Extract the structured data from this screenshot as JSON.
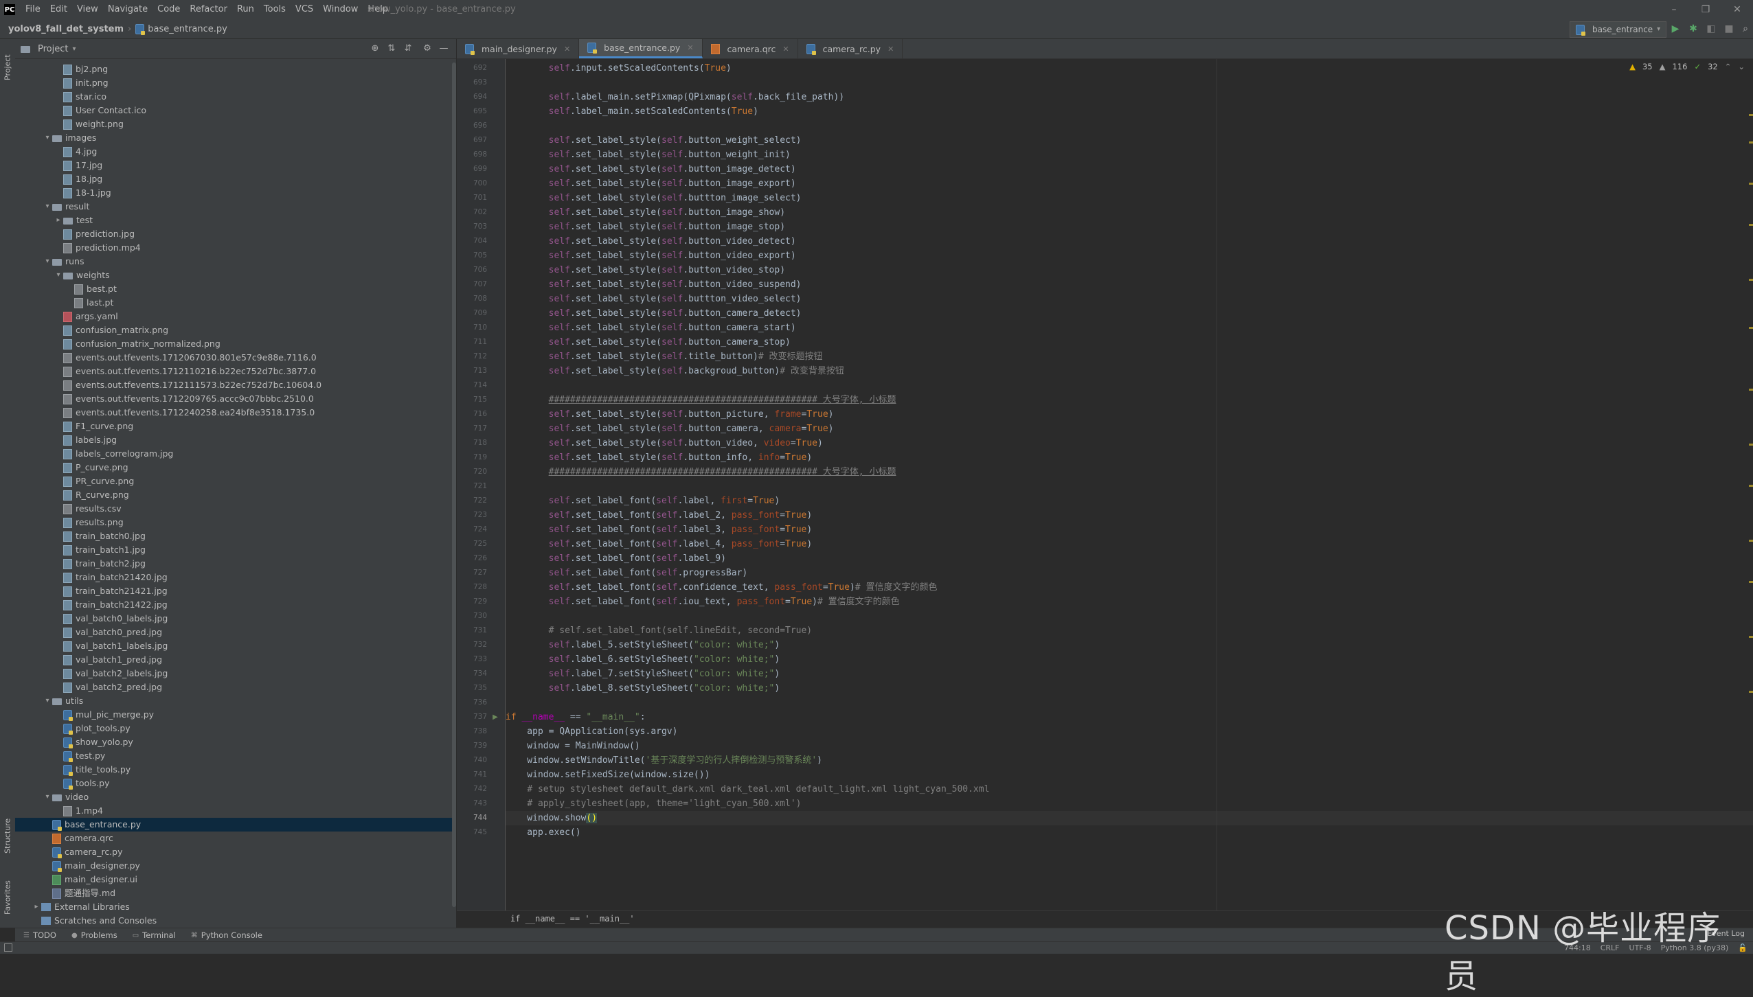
{
  "menubar": {
    "items": [
      "File",
      "Edit",
      "View",
      "Navigate",
      "Code",
      "Refactor",
      "Run",
      "Tools",
      "VCS",
      "Window",
      "Help"
    ],
    "window_title": "show_yolo.py - base_entrance.py"
  },
  "navbar": {
    "project": "yolov8_fall_det_system",
    "file": "base_entrance.py",
    "run_config": "base_entrance"
  },
  "stripe": {
    "project": "Project",
    "structure": "Structure",
    "favorites": "Favorites"
  },
  "project_panel": {
    "title": "Project"
  },
  "tree": [
    {
      "depth": 3,
      "name": "bj2.png",
      "icon": "file-img"
    },
    {
      "depth": 3,
      "name": "init.png",
      "icon": "file-img"
    },
    {
      "depth": 3,
      "name": "star.ico",
      "icon": "file-img"
    },
    {
      "depth": 3,
      "name": "User Contact.ico",
      "icon": "file-img"
    },
    {
      "depth": 3,
      "name": "weight.png",
      "icon": "file-img"
    },
    {
      "depth": 2,
      "name": "images",
      "icon": "folder",
      "chev": "v"
    },
    {
      "depth": 3,
      "name": "4.jpg",
      "icon": "file-img"
    },
    {
      "depth": 3,
      "name": "17.jpg",
      "icon": "file-img"
    },
    {
      "depth": 3,
      "name": "18.jpg",
      "icon": "file-img"
    },
    {
      "depth": 3,
      "name": "18-1.jpg",
      "icon": "file-img"
    },
    {
      "depth": 2,
      "name": "result",
      "icon": "folder",
      "chev": "v"
    },
    {
      "depth": 3,
      "name": "test",
      "icon": "folder",
      "chev": ">"
    },
    {
      "depth": 3,
      "name": "prediction.jpg",
      "icon": "file-img"
    },
    {
      "depth": 3,
      "name": "prediction.mp4",
      "icon": "file-gen"
    },
    {
      "depth": 2,
      "name": "runs",
      "icon": "folder",
      "chev": "v"
    },
    {
      "depth": 3,
      "name": "weights",
      "icon": "folder",
      "chev": "v"
    },
    {
      "depth": 4,
      "name": "best.pt",
      "icon": "file-gen"
    },
    {
      "depth": 4,
      "name": "last.pt",
      "icon": "file-gen"
    },
    {
      "depth": 3,
      "name": "args.yaml",
      "icon": "file-yaml"
    },
    {
      "depth": 3,
      "name": "confusion_matrix.png",
      "icon": "file-img"
    },
    {
      "depth": 3,
      "name": "confusion_matrix_normalized.png",
      "icon": "file-img"
    },
    {
      "depth": 3,
      "name": "events.out.tfevents.1712067030.801e57c9e88e.7116.0",
      "icon": "file-gen"
    },
    {
      "depth": 3,
      "name": "events.out.tfevents.1712110216.b22ec752d7bc.3877.0",
      "icon": "file-gen"
    },
    {
      "depth": 3,
      "name": "events.out.tfevents.1712111573.b22ec752d7bc.10604.0",
      "icon": "file-gen"
    },
    {
      "depth": 3,
      "name": "events.out.tfevents.1712209765.accc9c07bbbc.2510.0",
      "icon": "file-gen"
    },
    {
      "depth": 3,
      "name": "events.out.tfevents.1712240258.ea24bf8e3518.1735.0",
      "icon": "file-gen"
    },
    {
      "depth": 3,
      "name": "F1_curve.png",
      "icon": "file-img"
    },
    {
      "depth": 3,
      "name": "labels.jpg",
      "icon": "file-img"
    },
    {
      "depth": 3,
      "name": "labels_correlogram.jpg",
      "icon": "file-img"
    },
    {
      "depth": 3,
      "name": "P_curve.png",
      "icon": "file-img"
    },
    {
      "depth": 3,
      "name": "PR_curve.png",
      "icon": "file-img"
    },
    {
      "depth": 3,
      "name": "R_curve.png",
      "icon": "file-img"
    },
    {
      "depth": 3,
      "name": "results.csv",
      "icon": "file-gen"
    },
    {
      "depth": 3,
      "name": "results.png",
      "icon": "file-img"
    },
    {
      "depth": 3,
      "name": "train_batch0.jpg",
      "icon": "file-img"
    },
    {
      "depth": 3,
      "name": "train_batch1.jpg",
      "icon": "file-img"
    },
    {
      "depth": 3,
      "name": "train_batch2.jpg",
      "icon": "file-img"
    },
    {
      "depth": 3,
      "name": "train_batch21420.jpg",
      "icon": "file-img"
    },
    {
      "depth": 3,
      "name": "train_batch21421.jpg",
      "icon": "file-img"
    },
    {
      "depth": 3,
      "name": "train_batch21422.jpg",
      "icon": "file-img"
    },
    {
      "depth": 3,
      "name": "val_batch0_labels.jpg",
      "icon": "file-img"
    },
    {
      "depth": 3,
      "name": "val_batch0_pred.jpg",
      "icon": "file-img"
    },
    {
      "depth": 3,
      "name": "val_batch1_labels.jpg",
      "icon": "file-img"
    },
    {
      "depth": 3,
      "name": "val_batch1_pred.jpg",
      "icon": "file-img"
    },
    {
      "depth": 3,
      "name": "val_batch2_labels.jpg",
      "icon": "file-img"
    },
    {
      "depth": 3,
      "name": "val_batch2_pred.jpg",
      "icon": "file-img"
    },
    {
      "depth": 2,
      "name": "utils",
      "icon": "folder",
      "chev": "v"
    },
    {
      "depth": 3,
      "name": "mul_pic_merge.py",
      "icon": "file-py"
    },
    {
      "depth": 3,
      "name": "plot_tools.py",
      "icon": "file-py"
    },
    {
      "depth": 3,
      "name": "show_yolo.py",
      "icon": "file-py"
    },
    {
      "depth": 3,
      "name": "test.py",
      "icon": "file-py"
    },
    {
      "depth": 3,
      "name": "title_tools.py",
      "icon": "file-py"
    },
    {
      "depth": 3,
      "name": "tools.py",
      "icon": "file-py"
    },
    {
      "depth": 2,
      "name": "video",
      "icon": "folder",
      "chev": "v"
    },
    {
      "depth": 3,
      "name": "1.mp4",
      "icon": "file-gen"
    },
    {
      "depth": 2,
      "name": "base_entrance.py",
      "icon": "file-py",
      "selected": true
    },
    {
      "depth": 2,
      "name": "camera.qrc",
      "icon": "file-qrc"
    },
    {
      "depth": 2,
      "name": "camera_rc.py",
      "icon": "file-py"
    },
    {
      "depth": 2,
      "name": "main_designer.py",
      "icon": "file-py"
    },
    {
      "depth": 2,
      "name": "main_designer.ui",
      "icon": "file-ui"
    },
    {
      "depth": 2,
      "name": "题通指导.md",
      "icon": "file-md"
    },
    {
      "depth": 1,
      "name": "External Libraries",
      "icon": "file-lib",
      "chev": ">"
    },
    {
      "depth": 1,
      "name": "Scratches and Consoles",
      "icon": "file-lib",
      "chev": ""
    }
  ],
  "editor_tabs": [
    {
      "label": "main_designer.py",
      "icon": "file-py",
      "active": false
    },
    {
      "label": "base_entrance.py",
      "icon": "file-py",
      "active": true
    },
    {
      "label": "camera.qrc",
      "icon": "file-qrc",
      "active": false
    },
    {
      "label": "camera_rc.py",
      "icon": "file-py",
      "active": false
    }
  ],
  "inspection": {
    "warnings": "35",
    "weak_warnings": "116",
    "ok": "32"
  },
  "code": [
    {
      "n": "692",
      "html": "        <span class='slf'>self</span>.input.setScaledContents(<span class='kw'>True</span>)"
    },
    {
      "n": "693",
      "html": ""
    },
    {
      "n": "694",
      "html": "        <span class='slf'>self</span>.label_main.setPixmap(QPixmap(<span class='slf'>self</span>.back_file_path))"
    },
    {
      "n": "695",
      "html": "        <span class='slf'>self</span>.label_main.setScaledContents(<span class='kw'>True</span>)"
    },
    {
      "n": "696",
      "html": ""
    },
    {
      "n": "697",
      "html": "        <span class='slf'>self</span>.set_label_style(<span class='slf'>self</span>.button_weight_select)"
    },
    {
      "n": "698",
      "html": "        <span class='slf'>self</span>.set_label_style(<span class='slf'>self</span>.button_weight_init)"
    },
    {
      "n": "699",
      "html": "        <span class='slf'>self</span>.set_label_style(<span class='slf'>self</span>.button_image_detect)"
    },
    {
      "n": "700",
      "html": "        <span class='slf'>self</span>.set_label_style(<span class='slf'>self</span>.button_image_export)"
    },
    {
      "n": "701",
      "html": "        <span class='slf'>self</span>.set_label_style(<span class='slf'>self</span>.buttton_image_select)"
    },
    {
      "n": "702",
      "html": "        <span class='slf'>self</span>.set_label_style(<span class='slf'>self</span>.button_image_show)"
    },
    {
      "n": "703",
      "html": "        <span class='slf'>self</span>.set_label_style(<span class='slf'>self</span>.button_image_stop)"
    },
    {
      "n": "704",
      "html": "        <span class='slf'>self</span>.set_label_style(<span class='slf'>self</span>.button_video_detect)"
    },
    {
      "n": "705",
      "html": "        <span class='slf'>self</span>.set_label_style(<span class='slf'>self</span>.button_video_export)"
    },
    {
      "n": "706",
      "html": "        <span class='slf'>self</span>.set_label_style(<span class='slf'>self</span>.button_video_stop)"
    },
    {
      "n": "707",
      "html": "        <span class='slf'>self</span>.set_label_style(<span class='slf'>self</span>.button_video_suspend)"
    },
    {
      "n": "708",
      "html": "        <span class='slf'>self</span>.set_label_style(<span class='slf'>self</span>.buttton_video_select)"
    },
    {
      "n": "709",
      "html": "        <span class='slf'>self</span>.set_label_style(<span class='slf'>self</span>.button_camera_detect)"
    },
    {
      "n": "710",
      "html": "        <span class='slf'>self</span>.set_label_style(<span class='slf'>self</span>.button_camera_start)"
    },
    {
      "n": "711",
      "html": "        <span class='slf'>self</span>.set_label_style(<span class='slf'>self</span>.button_camera_stop)"
    },
    {
      "n": "712",
      "html": "        <span class='slf'>self</span>.set_label_style(<span class='slf'>self</span>.title_button)<span class='cmt'># 改变标题按钮</span>"
    },
    {
      "n": "713",
      "html": "        <span class='slf'>self</span>.set_label_style(<span class='slf'>self</span>.backgroud_button)<span class='cmt'># 改变背景按钮</span>"
    },
    {
      "n": "714",
      "html": ""
    },
    {
      "n": "715",
      "html": "        <span class='cmt ul'>################################################## 大号字体, 小标题</span>"
    },
    {
      "n": "716",
      "html": "        <span class='slf'>self</span>.set_label_style(<span class='slf'>self</span>.button_picture, <span class='prm'>frame</span>=<span class='kw'>True</span>)"
    },
    {
      "n": "717",
      "html": "        <span class='slf'>self</span>.set_label_style(<span class='slf'>self</span>.button_camera, <span class='prm'>camera</span>=<span class='kw'>True</span>)"
    },
    {
      "n": "718",
      "html": "        <span class='slf'>self</span>.set_label_style(<span class='slf'>self</span>.button_video, <span class='prm'>video</span>=<span class='kw'>True</span>)"
    },
    {
      "n": "719",
      "html": "        <span class='slf'>self</span>.set_label_style(<span class='slf'>self</span>.button_info, <span class='prm'>info</span>=<span class='kw'>True</span>)"
    },
    {
      "n": "720",
      "html": "        <span class='cmt ul'>################################################## 大号字体, 小标题</span>"
    },
    {
      "n": "721",
      "html": ""
    },
    {
      "n": "722",
      "html": "        <span class='slf'>self</span>.set_label_font(<span class='slf'>self</span>.label, <span class='prm'>first</span>=<span class='kw'>True</span>)"
    },
    {
      "n": "723",
      "html": "        <span class='slf'>self</span>.set_label_font(<span class='slf'>self</span>.label_2, <span class='prm'>pass_font</span>=<span class='kw'>True</span>)"
    },
    {
      "n": "724",
      "html": "        <span class='slf'>self</span>.set_label_font(<span class='slf'>self</span>.label_3, <span class='prm'>pass_font</span>=<span class='kw'>True</span>)"
    },
    {
      "n": "725",
      "html": "        <span class='slf'>self</span>.set_label_font(<span class='slf'>self</span>.label_4, <span class='prm'>pass_font</span>=<span class='kw'>True</span>)"
    },
    {
      "n": "726",
      "html": "        <span class='slf'>self</span>.set_label_font(<span class='slf'>self</span>.label_9)"
    },
    {
      "n": "727",
      "html": "        <span class='slf'>self</span>.set_label_font(<span class='slf'>self</span>.progressBar)"
    },
    {
      "n": "728",
      "html": "        <span class='slf'>self</span>.set_label_font(<span class='slf'>self</span>.confidence_text, <span class='prm'>pass_font</span>=<span class='kw'>True</span>)<span class='cmt'># 置信度文字的颜色</span>"
    },
    {
      "n": "729",
      "html": "        <span class='slf'>self</span>.set_label_font(<span class='slf'>self</span>.iou_text, <span class='prm'>pass_font</span>=<span class='kw'>True</span>)<span class='cmt'># 置信度文字的颜色</span>"
    },
    {
      "n": "730",
      "html": ""
    },
    {
      "n": "731",
      "html": "        <span class='cmt'># self.set_label_font(self.lineEdit, second=True)</span>"
    },
    {
      "n": "732",
      "html": "        <span class='slf'>self</span>.label_5.setStyleSheet(<span class='str'>\"color: white;\"</span>)"
    },
    {
      "n": "733",
      "html": "        <span class='slf'>self</span>.label_6.setStyleSheet(<span class='str'>\"color: white;\"</span>)"
    },
    {
      "n": "734",
      "html": "        <span class='slf'>self</span>.label_7.setStyleSheet(<span class='str'>\"color: white;\"</span>)"
    },
    {
      "n": "735",
      "html": "        <span class='slf'>self</span>.label_8.setStyleSheet(<span class='str'>\"color: white;\"</span>)"
    },
    {
      "n": "736",
      "html": ""
    },
    {
      "n": "737",
      "html": "<span class='kw'>if</span> <span class='dnd'>__name__</span> == <span class='str'>\"__main__\"</span>:"
    },
    {
      "n": "738",
      "html": "    app = QApplication(sys.argv)"
    },
    {
      "n": "739",
      "html": "    window = MainWindow()"
    },
    {
      "n": "740",
      "html": "    window.setWindowTitle(<span class='str'>'基于深度学习的行人摔倒检测与预警系统'</span>)"
    },
    {
      "n": "741",
      "html": "    window.setFixedSize(window.size())"
    },
    {
      "n": "742",
      "html": "    <span class='cmt'># setup stylesheet default_dark.xml dark_teal.xml default_light.xml light_cyan_500.xml</span>"
    },
    {
      "n": "743",
      "html": "    <span class='cmt'># apply_stylesheet(app, theme='light_cyan_500.xml')</span>"
    },
    {
      "n": "744",
      "html": "    window.show<span class='brace-hl'>()</span>",
      "current": true
    },
    {
      "n": "745",
      "html": "    app.exec()"
    }
  ],
  "editor_breadcrumb": "if __name__ == '__main__'",
  "bottom_tools": [
    "TODO",
    "Problems",
    "Terminal",
    "Python Console"
  ],
  "status": {
    "position": "744:18",
    "line_sep": "CRLF",
    "encoding": "UTF-8",
    "interpreter": "Python 3.8 (py38)",
    "event_log": "Event Log"
  },
  "watermark": "CSDN @毕业程序员"
}
